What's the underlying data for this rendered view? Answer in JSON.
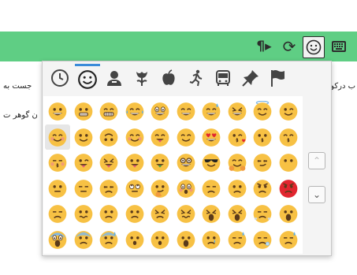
{
  "toolbar": {
    "buttons": [
      {
        "name": "pilcrow-rtl-icon",
        "glyph": "¶▸"
      },
      {
        "name": "refresh-icon",
        "glyph": "⟳"
      },
      {
        "name": "smiley-icon",
        "glyph": "☺"
      },
      {
        "name": "keyboard-icon",
        "glyph": ""
      }
    ],
    "background": "#5fce84"
  },
  "document": {
    "line1_left": "جست به",
    "line2_left": "ن گوهر ت",
    "line1_right": "ب درکويري بد"
  },
  "emoji_picker": {
    "tabs": [
      {
        "name": "recent",
        "glyph": "🕓",
        "active": false
      },
      {
        "name": "people",
        "glyph": "☺",
        "active": true
      },
      {
        "name": "person",
        "glyph": "👤",
        "active": false
      },
      {
        "name": "nature",
        "glyph": "🌷",
        "active": false
      },
      {
        "name": "food",
        "glyph": "🍎",
        "active": false
      },
      {
        "name": "activity",
        "glyph": "🏃",
        "active": false
      },
      {
        "name": "travel",
        "glyph": "🚌",
        "active": false
      },
      {
        "name": "objects",
        "glyph": "📌",
        "active": false
      },
      {
        "name": "flags",
        "glyph": "⚑",
        "active": false
      }
    ],
    "accent": "#3b8bd9",
    "face_color": "#f7c144",
    "angry_color": "#e1262f",
    "selected_index": 10,
    "emojis": [
      "grinning",
      "grimacing",
      "grin",
      "joy",
      "smiley",
      "smile",
      "sweat-smile",
      "laughing",
      "innocent",
      "wink",
      "blush",
      "slightly-smiling",
      "upside-down",
      "relaxed",
      "yum",
      "relieved",
      "heart-eyes",
      "kissing-heart",
      "kissing",
      "kissing-smiling-eyes",
      "kissing-closed-eyes",
      "stuck-out-tongue-winking",
      "stuck-out-tongue-closed",
      "stuck-out-tongue",
      "money-mouth",
      "nerd",
      "sunglasses",
      "hugging",
      "smirk",
      "no-mouth",
      "neutral",
      "expressionless",
      "unamused",
      "rolling-eyes",
      "thinking",
      "flushed",
      "disappointed",
      "worried",
      "angry",
      "rage",
      "pensive",
      "confused",
      "slightly-frowning",
      "frowning2",
      "persevere",
      "confounded",
      "tired",
      "weary",
      "triumph",
      "open-mouth",
      "scream",
      "fearful",
      "cold-sweat",
      "hushed",
      "frowning",
      "anguished",
      "cry",
      "disappointed-relieved",
      "sleepy",
      "sweat"
    ],
    "scroll": {
      "up": "⌃",
      "down": "⌄"
    }
  }
}
